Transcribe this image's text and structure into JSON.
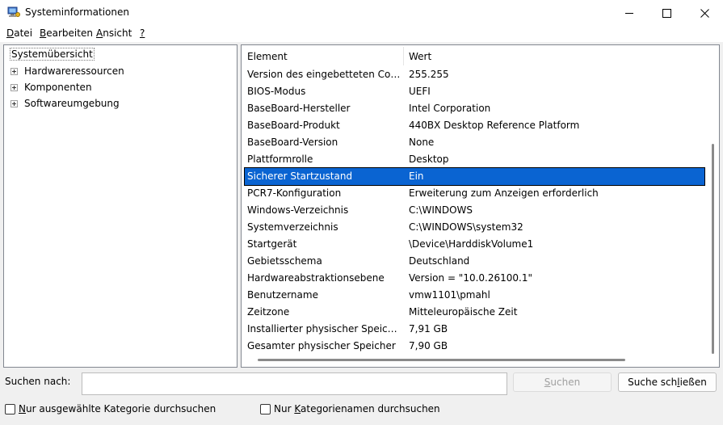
{
  "window": {
    "title": "Systeminformationen"
  },
  "menu": {
    "items": [
      {
        "pre": "",
        "ul": "D",
        "post": "atei"
      },
      {
        "pre": "",
        "ul": "B",
        "post": "earbeiten"
      },
      {
        "pre": "",
        "ul": "A",
        "post": "nsicht"
      },
      {
        "pre": "",
        "ul": "?",
        "post": ""
      }
    ]
  },
  "tree": {
    "root": "Systemübersicht",
    "nodes": [
      "Hardwareressourcen",
      "Komponenten",
      "Softwareumgebung"
    ]
  },
  "list": {
    "col_element": "Element",
    "col_value": "Wert",
    "rows": [
      {
        "element": "Version des eingebetteten Controllers",
        "value": "255.255"
      },
      {
        "element": "BIOS-Modus",
        "value": "UEFI"
      },
      {
        "element": "BaseBoard-Hersteller",
        "value": "Intel Corporation"
      },
      {
        "element": "BaseBoard-Produkt",
        "value": "440BX Desktop Reference Platform"
      },
      {
        "element": "BaseBoard-Version",
        "value": "None"
      },
      {
        "element": "Plattformrolle",
        "value": "Desktop"
      },
      {
        "element": "Sicherer Startzustand",
        "value": "Ein"
      },
      {
        "element": "PCR7-Konfiguration",
        "value": "Erweiterung zum Anzeigen erforderlich"
      },
      {
        "element": "Windows-Verzeichnis",
        "value": "C:\\WINDOWS"
      },
      {
        "element": "Systemverzeichnis",
        "value": "C:\\WINDOWS\\system32"
      },
      {
        "element": "Startgerät",
        "value": "\\Device\\HarddiskVolume1"
      },
      {
        "element": "Gebietsschema",
        "value": "Deutschland"
      },
      {
        "element": "Hardwareabstraktionsebene",
        "value": "Version = \"10.0.26100.1\""
      },
      {
        "element": "Benutzername",
        "value": "vmw1101\\pmahl"
      },
      {
        "element": "Zeitzone",
        "value": "Mitteleuropäische Zeit"
      },
      {
        "element": "Installierter physischer Speicher (RAM)",
        "value": "7,91 GB"
      },
      {
        "element": "Gesamter physischer Speicher",
        "value": "7,90 GB"
      }
    ],
    "selected_element": "Sicherer Startzustand"
  },
  "search": {
    "label": "Suchen nach:",
    "value": "",
    "btn_search": {
      "pre": "",
      "ul": "S",
      "post": "uchen"
    },
    "btn_close": {
      "pre": "Suche sch",
      "ul": "l",
      "post": "ießen"
    },
    "chk_selected": {
      "pre": "",
      "ul": "N",
      "post": "ur ausgewählte Kategorie durchsuchen",
      "checked": false
    },
    "chk_names": {
      "pre": "Nur ",
      "ul": "K",
      "post": "ategorienamen durchsuchen",
      "checked": false
    }
  }
}
